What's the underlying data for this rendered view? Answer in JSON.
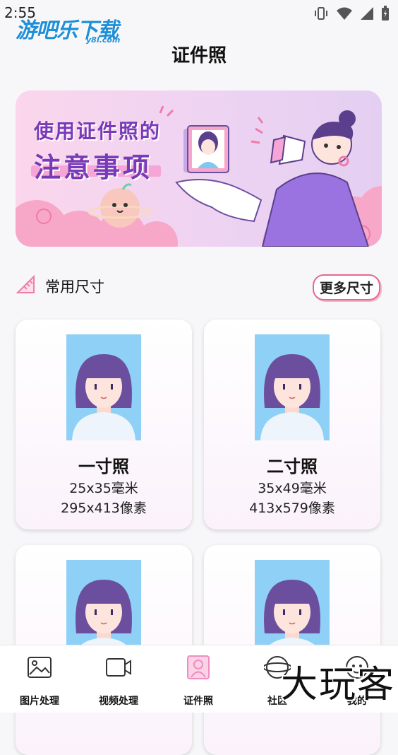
{
  "status_bar": {
    "time": "2:55"
  },
  "watermark": {
    "brand": "游吧乐下载",
    "domain": "y8l.com",
    "corner_mark": "大玩客"
  },
  "page": {
    "title": "证件照"
  },
  "banner": {
    "line1": "使用证件照的",
    "line2": "注意事项"
  },
  "section": {
    "label": "常用尺寸",
    "more_button": "更多尺寸"
  },
  "cards": [
    {
      "name": "一寸照",
      "mm": "25x35毫米",
      "px": "295x413像素"
    },
    {
      "name": "二寸照",
      "mm": "35x49毫米",
      "px": "413x579像素"
    },
    {
      "name": "",
      "mm": "",
      "px": ""
    },
    {
      "name": "",
      "mm": "",
      "px": ""
    }
  ],
  "tabbar": {
    "items": [
      {
        "label": "图片处理",
        "icon": "image-icon"
      },
      {
        "label": "视频处理",
        "icon": "video-icon"
      },
      {
        "label": "证件照",
        "icon": "id-photo-icon",
        "active": true
      },
      {
        "label": "社区",
        "icon": "community-icon"
      },
      {
        "label": "我的",
        "icon": "profile-icon"
      }
    ]
  },
  "colors": {
    "accent": "#f08cc0",
    "banner_text": "#7a3ab8",
    "photo_bg": "#8fd0f6",
    "hair": "#6b4e9e"
  }
}
